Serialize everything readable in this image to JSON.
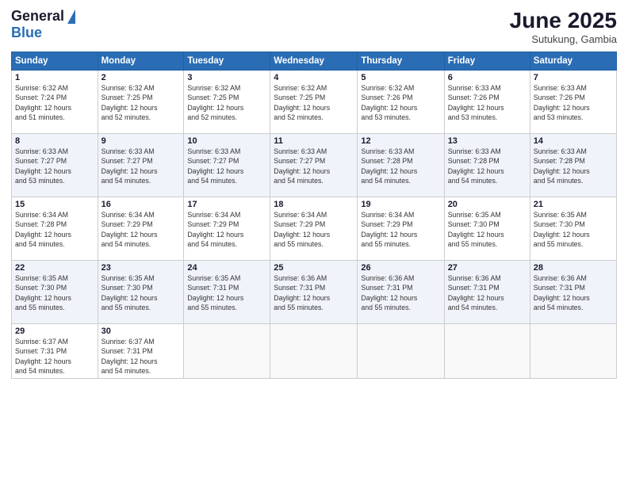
{
  "logo": {
    "general": "General",
    "blue": "Blue"
  },
  "title": "June 2025",
  "subtitle": "Sutukung, Gambia",
  "days_header": [
    "Sunday",
    "Monday",
    "Tuesday",
    "Wednesday",
    "Thursday",
    "Friday",
    "Saturday"
  ],
  "weeks": [
    [
      {
        "day": "1",
        "info": "Sunrise: 6:32 AM\nSunset: 7:24 PM\nDaylight: 12 hours\nand 51 minutes."
      },
      {
        "day": "2",
        "info": "Sunrise: 6:32 AM\nSunset: 7:25 PM\nDaylight: 12 hours\nand 52 minutes."
      },
      {
        "day": "3",
        "info": "Sunrise: 6:32 AM\nSunset: 7:25 PM\nDaylight: 12 hours\nand 52 minutes."
      },
      {
        "day": "4",
        "info": "Sunrise: 6:32 AM\nSunset: 7:25 PM\nDaylight: 12 hours\nand 52 minutes."
      },
      {
        "day": "5",
        "info": "Sunrise: 6:32 AM\nSunset: 7:26 PM\nDaylight: 12 hours\nand 53 minutes."
      },
      {
        "day": "6",
        "info": "Sunrise: 6:33 AM\nSunset: 7:26 PM\nDaylight: 12 hours\nand 53 minutes."
      },
      {
        "day": "7",
        "info": "Sunrise: 6:33 AM\nSunset: 7:26 PM\nDaylight: 12 hours\nand 53 minutes."
      }
    ],
    [
      {
        "day": "8",
        "info": "Sunrise: 6:33 AM\nSunset: 7:27 PM\nDaylight: 12 hours\nand 53 minutes."
      },
      {
        "day": "9",
        "info": "Sunrise: 6:33 AM\nSunset: 7:27 PM\nDaylight: 12 hours\nand 54 minutes."
      },
      {
        "day": "10",
        "info": "Sunrise: 6:33 AM\nSunset: 7:27 PM\nDaylight: 12 hours\nand 54 minutes."
      },
      {
        "day": "11",
        "info": "Sunrise: 6:33 AM\nSunset: 7:27 PM\nDaylight: 12 hours\nand 54 minutes."
      },
      {
        "day": "12",
        "info": "Sunrise: 6:33 AM\nSunset: 7:28 PM\nDaylight: 12 hours\nand 54 minutes."
      },
      {
        "day": "13",
        "info": "Sunrise: 6:33 AM\nSunset: 7:28 PM\nDaylight: 12 hours\nand 54 minutes."
      },
      {
        "day": "14",
        "info": "Sunrise: 6:33 AM\nSunset: 7:28 PM\nDaylight: 12 hours\nand 54 minutes."
      }
    ],
    [
      {
        "day": "15",
        "info": "Sunrise: 6:34 AM\nSunset: 7:28 PM\nDaylight: 12 hours\nand 54 minutes."
      },
      {
        "day": "16",
        "info": "Sunrise: 6:34 AM\nSunset: 7:29 PM\nDaylight: 12 hours\nand 54 minutes."
      },
      {
        "day": "17",
        "info": "Sunrise: 6:34 AM\nSunset: 7:29 PM\nDaylight: 12 hours\nand 54 minutes."
      },
      {
        "day": "18",
        "info": "Sunrise: 6:34 AM\nSunset: 7:29 PM\nDaylight: 12 hours\nand 55 minutes."
      },
      {
        "day": "19",
        "info": "Sunrise: 6:34 AM\nSunset: 7:29 PM\nDaylight: 12 hours\nand 55 minutes."
      },
      {
        "day": "20",
        "info": "Sunrise: 6:35 AM\nSunset: 7:30 PM\nDaylight: 12 hours\nand 55 minutes."
      },
      {
        "day": "21",
        "info": "Sunrise: 6:35 AM\nSunset: 7:30 PM\nDaylight: 12 hours\nand 55 minutes."
      }
    ],
    [
      {
        "day": "22",
        "info": "Sunrise: 6:35 AM\nSunset: 7:30 PM\nDaylight: 12 hours\nand 55 minutes."
      },
      {
        "day": "23",
        "info": "Sunrise: 6:35 AM\nSunset: 7:30 PM\nDaylight: 12 hours\nand 55 minutes."
      },
      {
        "day": "24",
        "info": "Sunrise: 6:35 AM\nSunset: 7:31 PM\nDaylight: 12 hours\nand 55 minutes."
      },
      {
        "day": "25",
        "info": "Sunrise: 6:36 AM\nSunset: 7:31 PM\nDaylight: 12 hours\nand 55 minutes."
      },
      {
        "day": "26",
        "info": "Sunrise: 6:36 AM\nSunset: 7:31 PM\nDaylight: 12 hours\nand 55 minutes."
      },
      {
        "day": "27",
        "info": "Sunrise: 6:36 AM\nSunset: 7:31 PM\nDaylight: 12 hours\nand 54 minutes."
      },
      {
        "day": "28",
        "info": "Sunrise: 6:36 AM\nSunset: 7:31 PM\nDaylight: 12 hours\nand 54 minutes."
      }
    ],
    [
      {
        "day": "29",
        "info": "Sunrise: 6:37 AM\nSunset: 7:31 PM\nDaylight: 12 hours\nand 54 minutes."
      },
      {
        "day": "30",
        "info": "Sunrise: 6:37 AM\nSunset: 7:31 PM\nDaylight: 12 hours\nand 54 minutes."
      },
      {
        "day": "",
        "info": ""
      },
      {
        "day": "",
        "info": ""
      },
      {
        "day": "",
        "info": ""
      },
      {
        "day": "",
        "info": ""
      },
      {
        "day": "",
        "info": ""
      }
    ]
  ]
}
